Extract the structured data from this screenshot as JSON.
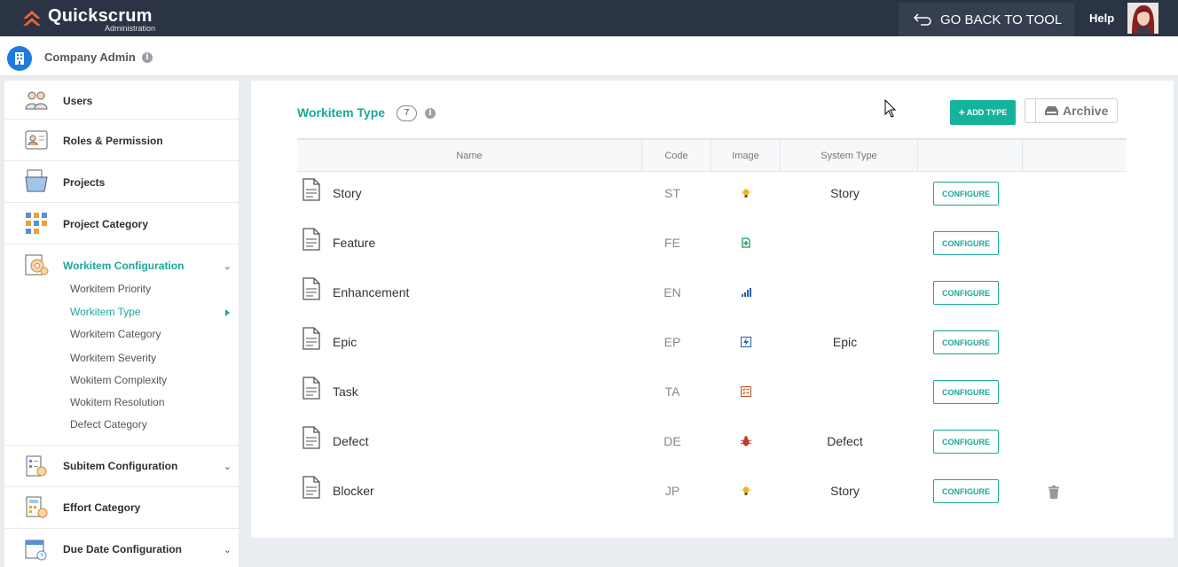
{
  "brand": {
    "name": "Quickscrum",
    "sub": "Administration",
    "accent": "#1aa89a"
  },
  "topbar": {
    "go_back": "GO BACK TO TOOL",
    "help": "Help"
  },
  "header": {
    "company": "Company Admin"
  },
  "sidebar": {
    "items": [
      {
        "label": "Users",
        "icon": "users-icon"
      },
      {
        "label": "Roles & Permission",
        "icon": "id-card-icon"
      },
      {
        "label": "Projects",
        "icon": "folder-icon"
      },
      {
        "label": "Project Category",
        "icon": "grid-icon"
      },
      {
        "label": "Workitem Configuration",
        "icon": "gear-doc-icon",
        "expanded": true
      },
      {
        "label": "Subitem Configuration",
        "icon": "checklist-gear-icon"
      },
      {
        "label": "Effort Category",
        "icon": "calculator-icon"
      },
      {
        "label": "Due Date Configuration",
        "icon": "calendar-clock-icon"
      }
    ],
    "workitem_sub": [
      "Workitem Priority",
      "Workitem Type",
      "Workitem Category",
      "Workitem Severity",
      "Wokitem Complexity",
      "Wokitem Resolution",
      "Defect Category"
    ]
  },
  "main": {
    "title": "Workitem Type",
    "count": "7",
    "add_button": "ADD TYPE",
    "archive_label": "Archive",
    "columns": [
      "Name",
      "Code",
      "Image",
      "System Type"
    ],
    "configure_label": "CONFIGURE",
    "rows": [
      {
        "name": "Story",
        "code": "ST",
        "image": "lightbulb-icon",
        "system_type": "Story"
      },
      {
        "name": "Feature",
        "code": "FE",
        "image": "feature-icon",
        "system_type": ""
      },
      {
        "name": "Enhancement",
        "code": "EN",
        "image": "bars-icon",
        "system_type": ""
      },
      {
        "name": "Epic",
        "code": "EP",
        "image": "lightning-icon",
        "system_type": "Epic"
      },
      {
        "name": "Task",
        "code": "TA",
        "image": "task-icon",
        "system_type": ""
      },
      {
        "name": "Defect",
        "code": "DE",
        "image": "bug-icon",
        "system_type": "Defect"
      },
      {
        "name": "Blocker",
        "code": "JP",
        "image": "lightbulb-icon",
        "system_type": "Story",
        "deletable": true
      }
    ]
  }
}
